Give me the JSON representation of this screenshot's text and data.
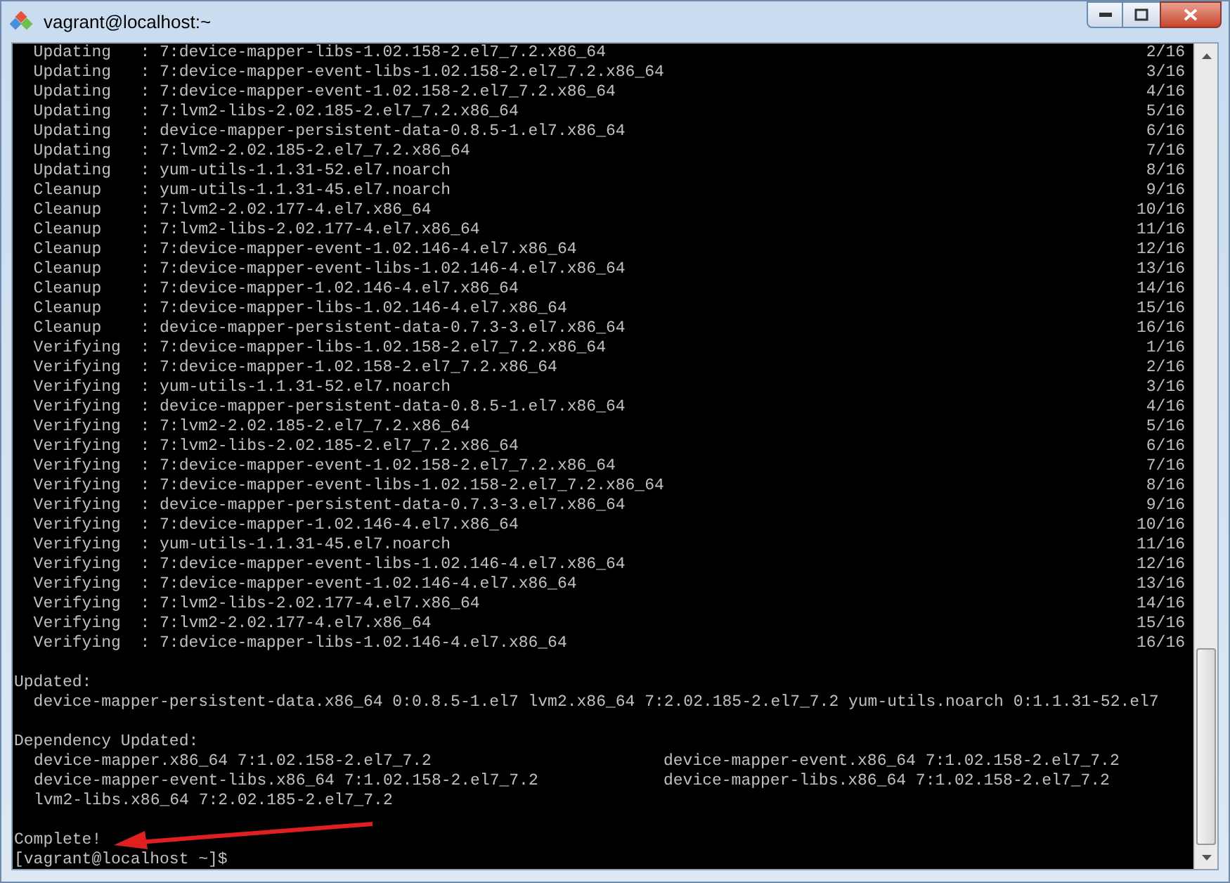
{
  "window": {
    "title": "vagrant@localhost:~"
  },
  "transactions": [
    {
      "line": "  Updating   : 7:device-mapper-libs-1.02.158-2.el7_7.2.x86_64",
      "count": "2/16"
    },
    {
      "line": "  Updating   : 7:device-mapper-event-libs-1.02.158-2.el7_7.2.x86_64",
      "count": "3/16"
    },
    {
      "line": "  Updating   : 7:device-mapper-event-1.02.158-2.el7_7.2.x86_64",
      "count": "4/16"
    },
    {
      "line": "  Updating   : 7:lvm2-libs-2.02.185-2.el7_7.2.x86_64",
      "count": "5/16"
    },
    {
      "line": "  Updating   : device-mapper-persistent-data-0.8.5-1.el7.x86_64",
      "count": "6/16"
    },
    {
      "line": "  Updating   : 7:lvm2-2.02.185-2.el7_7.2.x86_64",
      "count": "7/16"
    },
    {
      "line": "  Updating   : yum-utils-1.1.31-52.el7.noarch",
      "count": "8/16"
    },
    {
      "line": "  Cleanup    : yum-utils-1.1.31-45.el7.noarch",
      "count": "9/16"
    },
    {
      "line": "  Cleanup    : 7:lvm2-2.02.177-4.el7.x86_64",
      "count": "10/16"
    },
    {
      "line": "  Cleanup    : 7:lvm2-libs-2.02.177-4.el7.x86_64",
      "count": "11/16"
    },
    {
      "line": "  Cleanup    : 7:device-mapper-event-1.02.146-4.el7.x86_64",
      "count": "12/16"
    },
    {
      "line": "  Cleanup    : 7:device-mapper-event-libs-1.02.146-4.el7.x86_64",
      "count": "13/16"
    },
    {
      "line": "  Cleanup    : 7:device-mapper-1.02.146-4.el7.x86_64",
      "count": "14/16"
    },
    {
      "line": "  Cleanup    : 7:device-mapper-libs-1.02.146-4.el7.x86_64",
      "count": "15/16"
    },
    {
      "line": "  Cleanup    : device-mapper-persistent-data-0.7.3-3.el7.x86_64",
      "count": "16/16"
    },
    {
      "line": "  Verifying  : 7:device-mapper-libs-1.02.158-2.el7_7.2.x86_64",
      "count": "1/16"
    },
    {
      "line": "  Verifying  : 7:device-mapper-1.02.158-2.el7_7.2.x86_64",
      "count": "2/16"
    },
    {
      "line": "  Verifying  : yum-utils-1.1.31-52.el7.noarch",
      "count": "3/16"
    },
    {
      "line": "  Verifying  : device-mapper-persistent-data-0.8.5-1.el7.x86_64",
      "count": "4/16"
    },
    {
      "line": "  Verifying  : 7:lvm2-2.02.185-2.el7_7.2.x86_64",
      "count": "5/16"
    },
    {
      "line": "  Verifying  : 7:lvm2-libs-2.02.185-2.el7_7.2.x86_64",
      "count": "6/16"
    },
    {
      "line": "  Verifying  : 7:device-mapper-event-1.02.158-2.el7_7.2.x86_64",
      "count": "7/16"
    },
    {
      "line": "  Verifying  : 7:device-mapper-event-libs-1.02.158-2.el7_7.2.x86_64",
      "count": "8/16"
    },
    {
      "line": "  Verifying  : device-mapper-persistent-data-0.7.3-3.el7.x86_64",
      "count": "9/16"
    },
    {
      "line": "  Verifying  : 7:device-mapper-1.02.146-4.el7.x86_64",
      "count": "10/16"
    },
    {
      "line": "  Verifying  : yum-utils-1.1.31-45.el7.noarch",
      "count": "11/16"
    },
    {
      "line": "  Verifying  : 7:device-mapper-event-libs-1.02.146-4.el7.x86_64",
      "count": "12/16"
    },
    {
      "line": "  Verifying  : 7:device-mapper-event-1.02.146-4.el7.x86_64",
      "count": "13/16"
    },
    {
      "line": "  Verifying  : 7:lvm2-libs-2.02.177-4.el7.x86_64",
      "count": "14/16"
    },
    {
      "line": "  Verifying  : 7:lvm2-2.02.177-4.el7.x86_64",
      "count": "15/16"
    },
    {
      "line": "  Verifying  : 7:device-mapper-libs-1.02.146-4.el7.x86_64",
      "count": "16/16"
    }
  ],
  "updated": {
    "heading": "Updated:",
    "packages": [
      "  device-mapper-persistent-data.x86_64 0:0.8.5-1.el7 lvm2.x86_64 7:2.02.185-2.el7_7.2 yum-utils.noarch 0:1.1.31-52.el7"
    ]
  },
  "dependency_updated": {
    "heading": "Dependency Updated:",
    "packages": [
      "device-mapper.x86_64 7:1.02.158-2.el7_7.2",
      "device-mapper-event.x86_64 7:1.02.158-2.el7_7.2",
      "device-mapper-event-libs.x86_64 7:1.02.158-2.el7_7.2",
      "device-mapper-libs.x86_64 7:1.02.158-2.el7_7.2",
      "lvm2-libs.x86_64 7:2.02.185-2.el7_7.2"
    ]
  },
  "result": "Complete!",
  "prompt": "[vagrant@localhost ~]$"
}
